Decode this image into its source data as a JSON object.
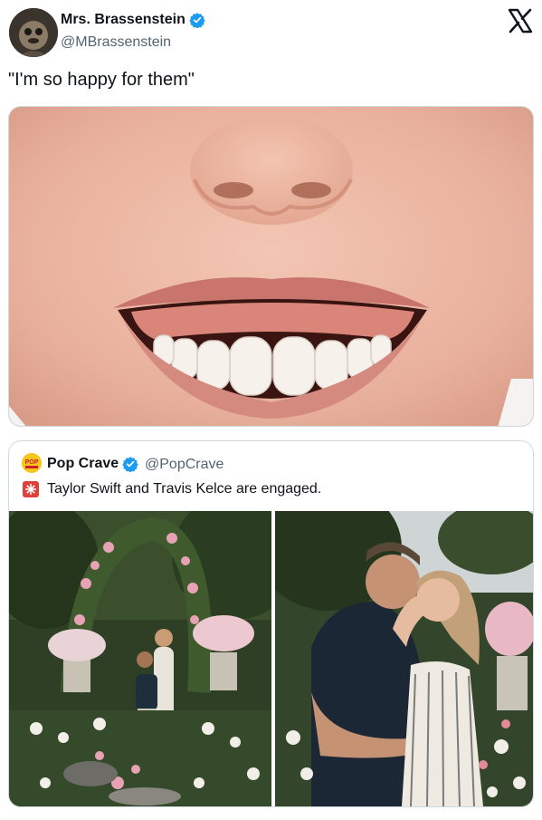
{
  "tweet": {
    "author_name": "Mrs. Brassenstein",
    "author_handle": "@MBrassenstein",
    "verified": true,
    "text": "\"I'm so happy for them\"",
    "media_icon": "smiling-mouth-closeup-image"
  },
  "platform_logo": "x-logo-icon",
  "quoted_tweet": {
    "author_name": "Pop Crave",
    "author_handle": "@PopCrave",
    "verified": true,
    "avatar_text": "POP",
    "emoji_icon": "siren-icon",
    "text": "Taylor Swift and Travis Kelce are engaged.",
    "photos": [
      "garden-proposal-photo",
      "couple-embrace-photo"
    ]
  },
  "colors": {
    "verified": "#1d9bf0",
    "handle_gray": "#536471",
    "border": "#cfd9de",
    "skin": "#e7b39f",
    "lips": "#c9746c"
  }
}
